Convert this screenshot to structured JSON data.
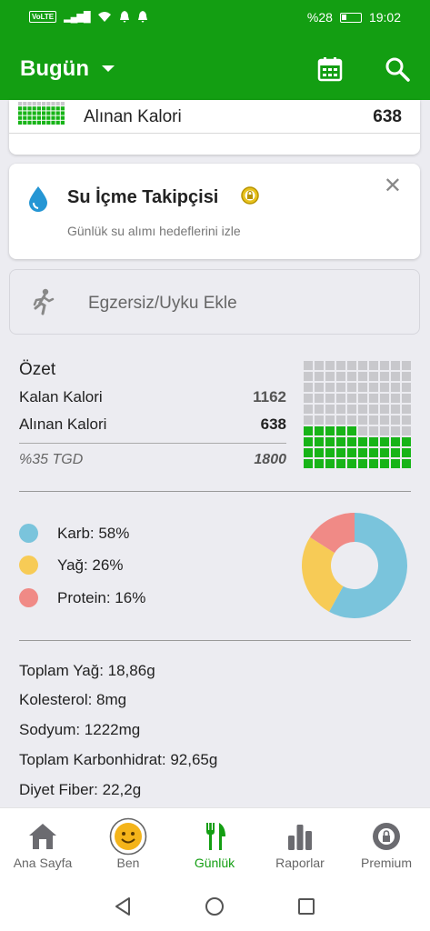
{
  "status_bar": {
    "volte": "VoLTE",
    "battery": "%28",
    "time": "19:02"
  },
  "app_bar": {
    "title": "Bugün",
    "icons": [
      "calendar-icon",
      "search-icon"
    ]
  },
  "calories_row": {
    "label": "Alınan Kalori",
    "value": "638"
  },
  "water_card": {
    "title": "Su İçme Takipçisi",
    "subtitle": "Günlük su alımı hedeflerini izle"
  },
  "exercise": {
    "label": "Egzersiz/Uyku Ekle"
  },
  "summary": {
    "title": "Özet",
    "remaining_label": "Kalan Kalori",
    "remaining_value": "1162",
    "consumed_label": "Alınan Kalori",
    "consumed_value": "638",
    "tgd_label": "%35 TGD",
    "tgd_value": "1800",
    "consumed_fraction": 0.35
  },
  "macros": [
    {
      "label": "Karb: 58%",
      "percent": 58,
      "color": "#7ac4dc"
    },
    {
      "label": "Yağ: 26%",
      "percent": 26,
      "color": "#f7cb56"
    },
    {
      "label": "Protein: 16%",
      "percent": 16,
      "color": "#f08a86"
    }
  ],
  "nutrients": [
    "Toplam Yağ: 18,86g",
    "Kolesterol: 8mg",
    "Sodyum: 1222mg",
    "Toplam Karbonhidrat: 92,65g",
    "Diyet Fiber: 22,2g"
  ],
  "tabs": [
    {
      "label": "Ana Sayfa",
      "icon": "home-icon"
    },
    {
      "label": "Ben",
      "icon": "avatar-icon"
    },
    {
      "label": "Günlük",
      "icon": "fork-knife-icon"
    },
    {
      "label": "Raporlar",
      "icon": "bar-chart-icon"
    },
    {
      "label": "Premium",
      "icon": "premium-badge-icon"
    }
  ],
  "colors": {
    "brand": "#139e12",
    "waffle_on": "#17b417",
    "waffle_off": "#c8c8cc"
  }
}
